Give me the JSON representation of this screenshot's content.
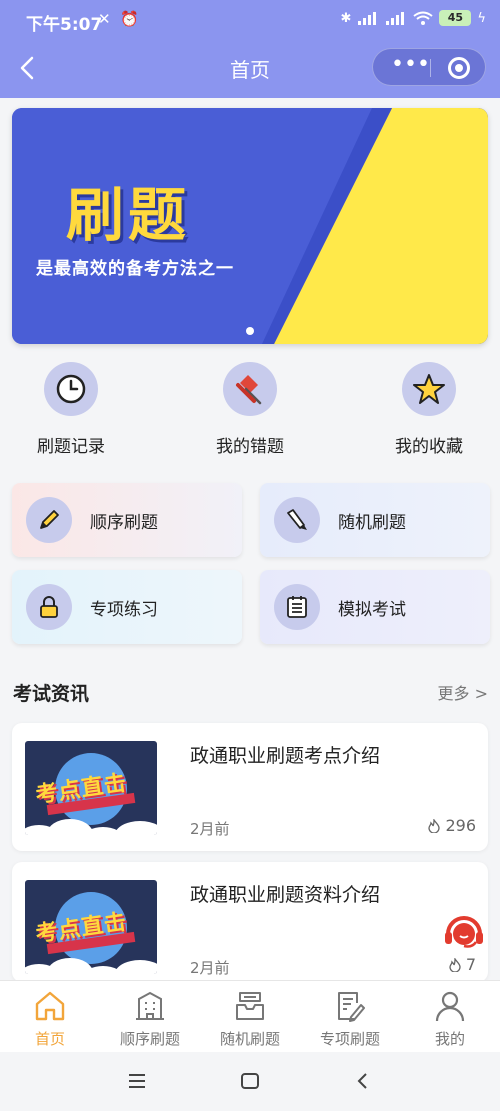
{
  "status": {
    "time": "下午5:07",
    "battery": "45"
  },
  "nav": {
    "title": "首页",
    "more_icon": "more-dots-icon",
    "close_icon": "record-circle-icon"
  },
  "banner": {
    "title": "刷题",
    "subtitle": "是最高效的备考方法之一"
  },
  "shortcuts": [
    {
      "label": "刷题记录",
      "icon": "clock-icon"
    },
    {
      "label": "我的错题",
      "icon": "pin-icon"
    },
    {
      "label": "我的收藏",
      "icon": "star-icon"
    }
  ],
  "practice": [
    {
      "label": "顺序刷题",
      "icon": "pencil-icon"
    },
    {
      "label": "随机刷题",
      "icon": "brush-icon"
    },
    {
      "label": "专项练习",
      "icon": "lock-icon"
    },
    {
      "label": "模拟考试",
      "icon": "list-icon"
    }
  ],
  "news_section": {
    "title": "考试资讯",
    "more": "更多 >"
  },
  "news": [
    {
      "title": "政通职业刷题考点介绍",
      "time": "2月前",
      "views": "296",
      "thumb_text": "考点直击"
    },
    {
      "title": "政通职业刷题资料介绍",
      "time": "2月前",
      "views": "7",
      "thumb_text": "考点直击"
    }
  ],
  "tabs": [
    {
      "label": "首页",
      "active": true
    },
    {
      "label": "顺序刷题"
    },
    {
      "label": "随机刷题"
    },
    {
      "label": "专项刷题"
    },
    {
      "label": "我的"
    }
  ],
  "colors": {
    "header": "#8b95ef",
    "accent": "#f2a53a",
    "banner_blue": "#4a5ed6",
    "banner_yellow": "#ffe94a"
  }
}
